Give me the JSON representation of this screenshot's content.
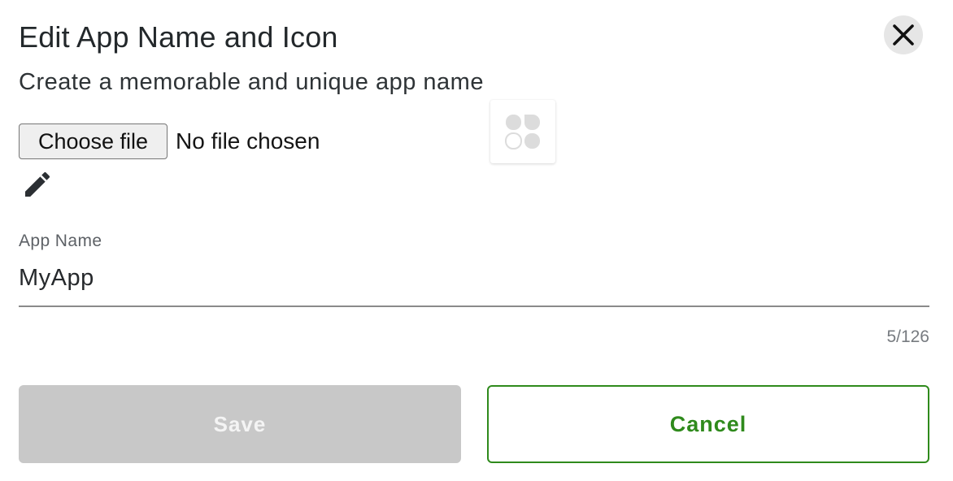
{
  "dialog": {
    "title": "Edit App Name and Icon",
    "subtitle": "Create a memorable and unique app name",
    "close_icon": "close-icon"
  },
  "file_input": {
    "button_label": "Choose file",
    "status": "No file chosen"
  },
  "icon_preview": {
    "icon": "clover-app-icon"
  },
  "edit_icon": "pencil-icon",
  "app_name_field": {
    "label": "App Name",
    "value": "MyApp",
    "counter": "5/126"
  },
  "actions": {
    "save_label": "Save",
    "cancel_label": "Cancel"
  },
  "colors": {
    "accent_green": "#2f8a1c",
    "disabled_gray": "#c8c8c8"
  }
}
